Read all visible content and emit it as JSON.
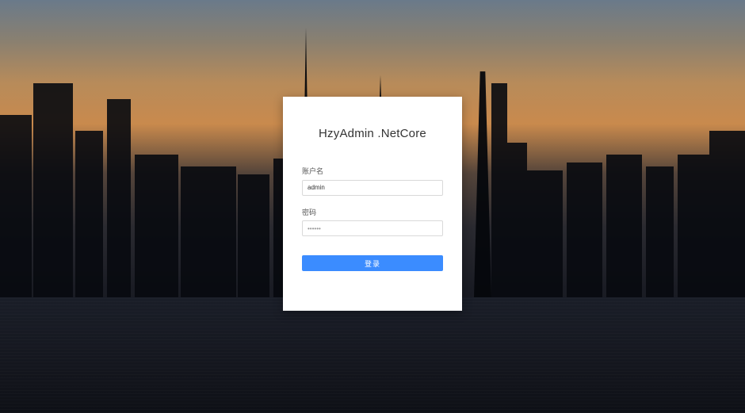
{
  "title": "HzyAdmin .NetCore",
  "form": {
    "username": {
      "label": "账户名",
      "value": "admin"
    },
    "password": {
      "label": "密码",
      "placeholder": "••••••"
    },
    "submit": "登录"
  }
}
